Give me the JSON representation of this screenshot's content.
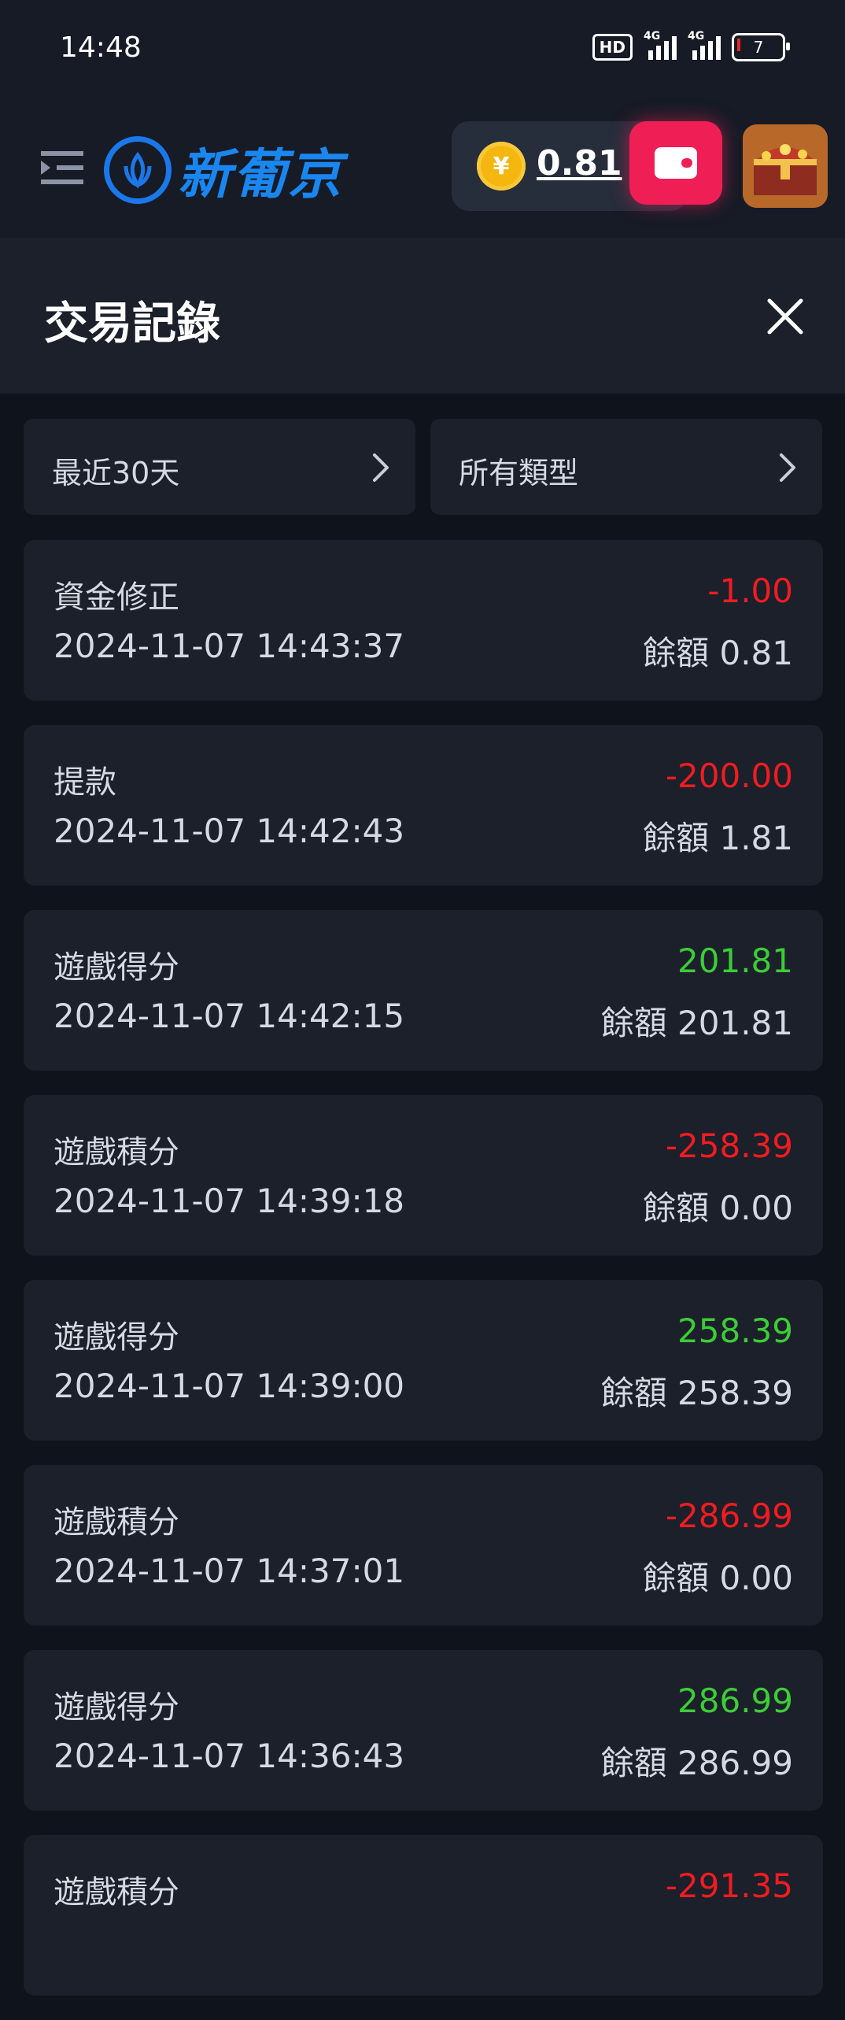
{
  "status_bar": {
    "time": "14:48",
    "hd_label": "HD",
    "network_1": "4G",
    "network_2": "4G",
    "battery_level": "7"
  },
  "header": {
    "logo_text": "新葡京",
    "balance": "0.81",
    "icons": {
      "menu": "menu-icon",
      "coin": "coin-icon",
      "wallet": "wallet-icon",
      "treasure": "treasure-chest-icon"
    },
    "colors": {
      "wallet_button": "#ef1f55",
      "coin": "#f5b60f",
      "logo": "#1a86f0"
    }
  },
  "page": {
    "title": "交易記錄",
    "close_icon": "close-icon"
  },
  "filters": {
    "date_range": "最近30天",
    "type": "所有類型"
  },
  "transactions": [
    {
      "type": "資金修正",
      "amount": "-1.00",
      "time": "2024-11-07 14:43:37",
      "balance": "餘額 0.81",
      "sign": "neg"
    },
    {
      "type": "提款",
      "amount": "-200.00",
      "time": "2024-11-07 14:42:43",
      "balance": "餘額 1.81",
      "sign": "neg"
    },
    {
      "type": "遊戲得分",
      "amount": "201.81",
      "time": "2024-11-07 14:42:15",
      "balance": "餘額 201.81",
      "sign": "pos"
    },
    {
      "type": "遊戲積分",
      "amount": "-258.39",
      "time": "2024-11-07 14:39:18",
      "balance": "餘額 0.00",
      "sign": "neg"
    },
    {
      "type": "遊戲得分",
      "amount": "258.39",
      "time": "2024-11-07 14:39:00",
      "balance": "餘額 258.39",
      "sign": "pos"
    },
    {
      "type": "遊戲積分",
      "amount": "-286.99",
      "time": "2024-11-07 14:37:01",
      "balance": "餘額 0.00",
      "sign": "neg"
    },
    {
      "type": "遊戲得分",
      "amount": "286.99",
      "time": "2024-11-07 14:36:43",
      "balance": "餘額 286.99",
      "sign": "pos"
    },
    {
      "type": "遊戲積分",
      "amount": "-291.35",
      "time": "",
      "balance": "",
      "sign": "neg"
    }
  ],
  "colors": {
    "negative": "#f01c20",
    "positive": "#3ccd36",
    "card_bg": "#1b202b",
    "page_bg": "#0f131b"
  }
}
